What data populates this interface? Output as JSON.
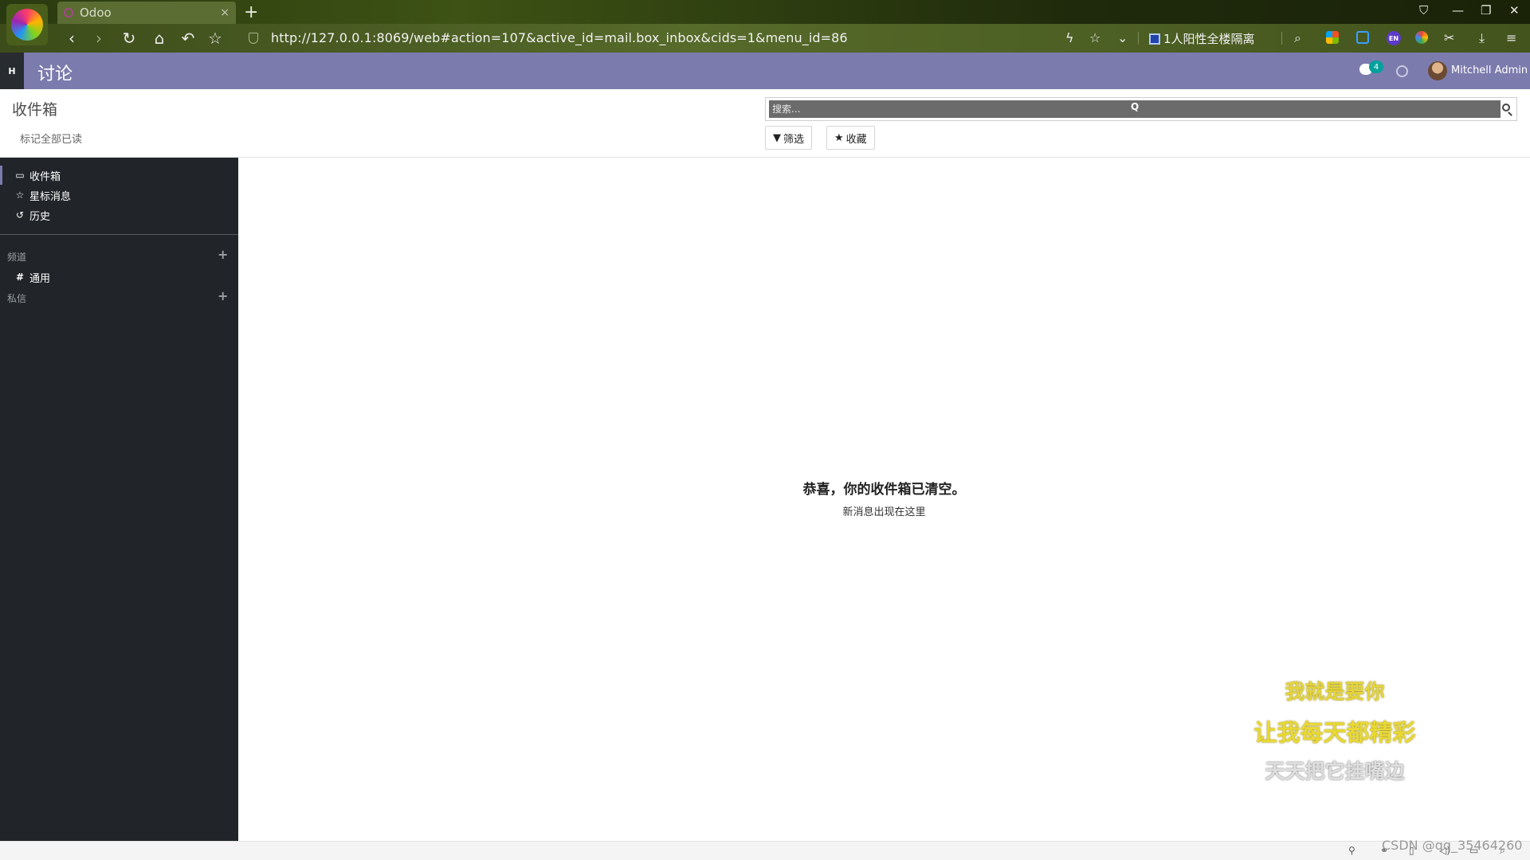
{
  "browser": {
    "tab_title": "Odoo",
    "tab_close": "×",
    "new_tab": "+",
    "url": "http://127.0.0.1:8069/web#action=107&active_id=mail.box_inbox&cids=1&menu_id=86",
    "news_ticker": "1人阳性全楼隔离",
    "lang_badge": "EN"
  },
  "navbar": {
    "apps_label": "H",
    "app_title": "讨论",
    "chat_count": "4",
    "user_name": "Mitchell Admin",
    "accent_color": "#7c7bad"
  },
  "control_panel": {
    "breadcrumb": "收件箱",
    "mark_all_read": "标记全部已读",
    "search_placeholder": "搜索...",
    "search_mid_glyph": "Q",
    "filter_label": "筛选",
    "favorites_label": "收藏"
  },
  "sidebar": {
    "mailboxes": [
      {
        "label": "收件箱",
        "icon": "inbox-icon"
      },
      {
        "label": "星标消息",
        "icon": "star-icon"
      },
      {
        "label": "历史",
        "icon": "history-icon"
      }
    ],
    "channels_header": "频道",
    "channels": [
      {
        "label": "通用",
        "icon": "hashtag-icon"
      }
    ],
    "direct_messages_header": "私信"
  },
  "main": {
    "empty_title": "恭喜，你的收件箱已清空。",
    "empty_subtitle": "新消息出现在这里"
  },
  "overlay": {
    "line1": "我就是要你",
    "line2": "让我每天都精彩",
    "line3": "天天把它挂嘴边"
  },
  "watermark": "CSDN @qq_35464260"
}
